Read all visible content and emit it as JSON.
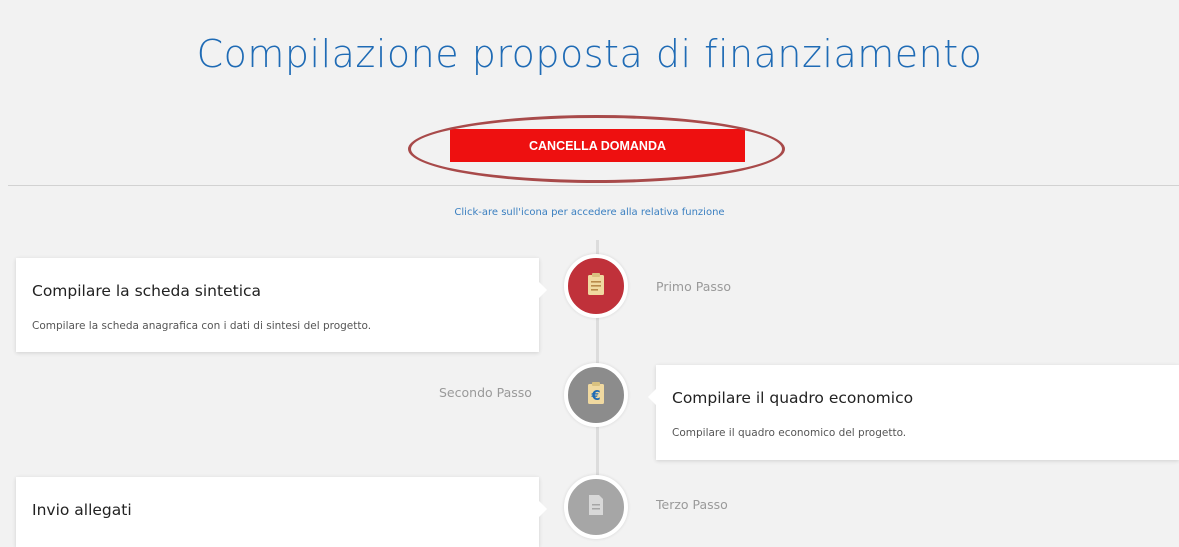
{
  "page": {
    "title": "Compilazione proposta di finanziamento",
    "cancel_button": "CANCELLA DOMANDA",
    "hint": "Click-are sull'icona per accedere alla relativa funzione"
  },
  "steps": [
    {
      "label": "Primo Passo",
      "title": "Compilare la scheda sintetica",
      "description": "Compilare la scheda anagrafica con i dati di sintesi del progetto.",
      "icon": "clipboard-icon",
      "color": "#c0313a"
    },
    {
      "label": "Secondo Passo",
      "title": "Compilare il quadro economico",
      "description": "Compilare il quadro economico del progetto.",
      "icon": "euro-clipboard-icon",
      "color": "#8c8c8c"
    },
    {
      "label": "Terzo Passo",
      "title": "Invio allegati",
      "icon": "document-icon",
      "color": "#a6a6a6"
    }
  ],
  "colors": {
    "title": "#1f6bb5",
    "cancel_button": "#ee1010",
    "annotation_ellipse": "#a84a4a",
    "hint": "#3a7fc0"
  }
}
